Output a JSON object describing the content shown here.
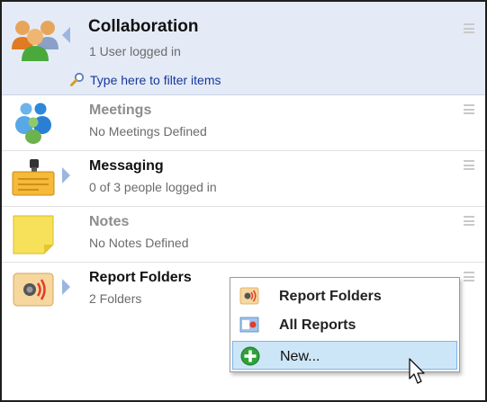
{
  "header": {
    "title": "Collaboration",
    "subtitle": "1 User logged in",
    "filter_placeholder": "Type here to filter items",
    "icon": "people-group-icon"
  },
  "items": [
    {
      "title": "Meetings",
      "subtitle": "No Meetings Defined",
      "enabled": false,
      "expandable": false,
      "icon": "meetings-people-icon"
    },
    {
      "title": "Messaging",
      "subtitle": "0 of 3 people logged in",
      "enabled": true,
      "expandable": true,
      "icon": "messaging-pager-icon"
    },
    {
      "title": "Notes",
      "subtitle": "No Notes Defined",
      "enabled": false,
      "expandable": false,
      "icon": "sticky-note-icon"
    },
    {
      "title": "Report Folders",
      "subtitle": "2 Folders",
      "enabled": true,
      "expandable": true,
      "icon": "report-folder-speaker-icon"
    }
  ],
  "context_menu": {
    "items": [
      {
        "label": "Report Folders",
        "icon": "report-folder-icon"
      },
      {
        "label": "All Reports",
        "icon": "all-reports-icon"
      },
      {
        "label": "New...",
        "icon": "add-green-plus-icon",
        "highlighted": true
      }
    ]
  },
  "colors": {
    "header_bg": "#e4ebf7",
    "link_blue": "#15379a",
    "arrow_blue": "#9bb6df",
    "highlight_bg": "#cde6f7"
  }
}
